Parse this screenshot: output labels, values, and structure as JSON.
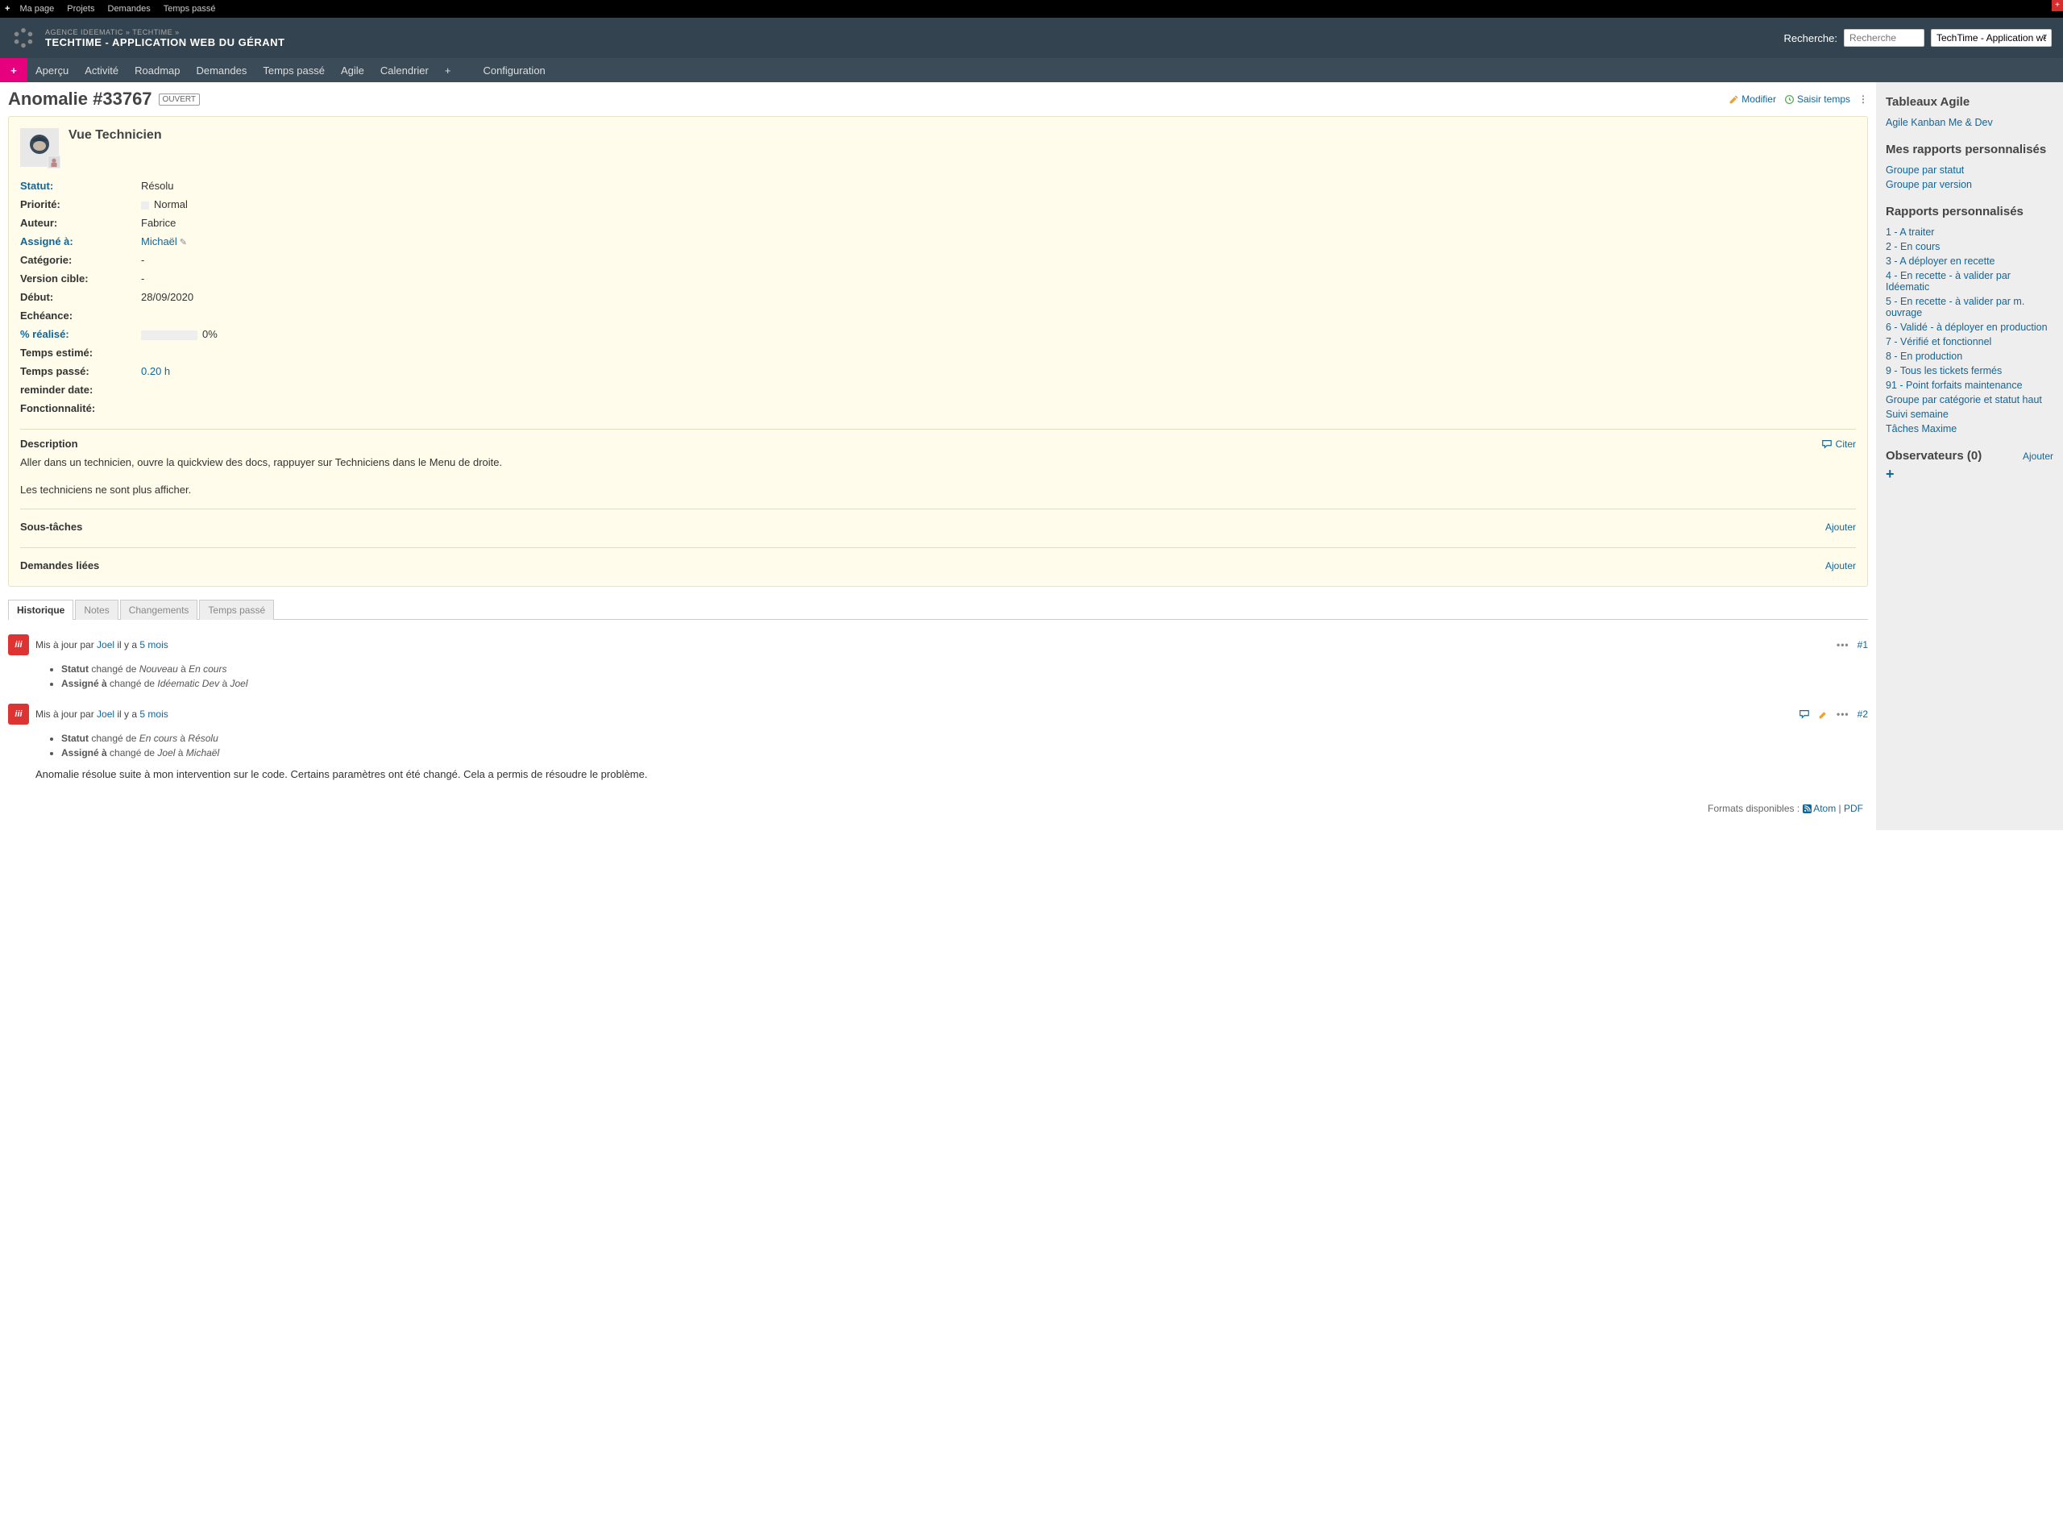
{
  "topbar": {
    "items": [
      "Ma page",
      "Projets",
      "Demandes",
      "Temps passé"
    ]
  },
  "header": {
    "crumb": "AGENCE IDEEMATIC » TECHTIME »",
    "title": "TECHTIME - APPLICATION WEB DU GÉRANT",
    "search_label": "Recherche:",
    "search_placeholder": "Recherche",
    "project_select": "TechTime - Application web d..."
  },
  "nav": {
    "items": [
      "Aperçu",
      "Activité",
      "Roadmap",
      "Demandes",
      "Temps passé",
      "Agile",
      "Calendrier",
      "+"
    ],
    "config": "Configuration"
  },
  "issue": {
    "title": "Anomalie #33767",
    "badge": "OUVERT",
    "actions": {
      "modifier": "Modifier",
      "saisir": "Saisir temps"
    },
    "subject": "Vue Technicien",
    "fields": {
      "statut_label": "Statut:",
      "statut_value": "Résolu",
      "priorite_label": "Priorité:",
      "priorite_value": "Normal",
      "auteur_label": "Auteur:",
      "auteur_value": "Fabrice",
      "assigne_label": "Assigné à:",
      "assigne_value": "Michaël",
      "categorie_label": "Catégorie:",
      "categorie_value": "-",
      "version_label": "Version cible:",
      "version_value": "-",
      "debut_label": "Début:",
      "debut_value": "28/09/2020",
      "echeance_label": "Echéance:",
      "echeance_value": "",
      "realise_label": "% réalisé:",
      "realise_value": "0%",
      "estime_label": "Temps estimé:",
      "estime_value": "",
      "passe_label": "Temps passé:",
      "passe_value": "0.20 h",
      "reminder_label": "reminder date:",
      "reminder_value": "",
      "fonc_label": "Fonctionnalité:",
      "fonc_value": ""
    },
    "description": {
      "title": "Description",
      "citer": "Citer",
      "p1": "Aller dans un technicien, ouvre la quickview des docs, rappuyer sur Techniciens dans le Menu de droite.",
      "p2": "Les techniciens ne sont plus afficher."
    },
    "subtasks": {
      "title": "Sous-tâches",
      "ajouter": "Ajouter"
    },
    "related": {
      "title": "Demandes liées",
      "ajouter": "Ajouter"
    }
  },
  "tabs": [
    "Historique",
    "Notes",
    "Changements",
    "Temps passé"
  ],
  "history": {
    "entries": [
      {
        "prefix": "Mis à jour par ",
        "user": "Joel",
        "mid": " il y a ",
        "ago": "5 mois",
        "num": "#1",
        "changes": [
          {
            "field": "Statut",
            "txt": " changé de ",
            "from": "Nouveau",
            "to_txt": " à ",
            "to": "En cours"
          },
          {
            "field": "Assigné à",
            "txt": " changé de ",
            "from": "Idéematic Dev",
            "to_txt": " à ",
            "to": "Joel"
          }
        ]
      },
      {
        "prefix": "Mis à jour par ",
        "user": "Joel",
        "mid": " il y a ",
        "ago": "5 mois",
        "num": "#2",
        "has_comment_icons": true,
        "changes": [
          {
            "field": "Statut",
            "txt": " changé de ",
            "from": "En cours",
            "to_txt": " à ",
            "to": "Résolu"
          },
          {
            "field": "Assigné à",
            "txt": " changé de ",
            "from": "Joel",
            "to_txt": " à ",
            "to": "Michaël"
          }
        ],
        "note": "Anomalie résolue suite à mon intervention sur le code. Certains paramètres ont été changé. Cela a permis de résoudre le problème."
      }
    ]
  },
  "formats": {
    "label": "Formats disponibles : ",
    "atom": "Atom",
    "pdf": "PDF"
  },
  "sidebar": {
    "agile_title": "Tableaux Agile",
    "agile_link": "Agile Kanban Me & Dev",
    "mes_rapports_title": "Mes rapports personnalisés",
    "mes_rapports": [
      "Groupe par statut",
      "Groupe par version"
    ],
    "rapports_title": "Rapports personnalisés",
    "rapports": [
      "1 - A traiter",
      "2 - En cours",
      "3 - A déployer en recette",
      "4 - En recette - à valider par Idéematic",
      "5 - En recette - à valider par m. ouvrage",
      "6 - Validé - à déployer en production",
      "7 - Vérifié et fonctionnel",
      "8 - En production",
      "9 - Tous les tickets fermés",
      "91 - Point forfaits maintenance",
      "Groupe par catégorie et statut haut",
      "Suivi semaine",
      "Tâches Maxime"
    ],
    "obs_title": "Observateurs (0)",
    "obs_ajouter": "Ajouter"
  }
}
